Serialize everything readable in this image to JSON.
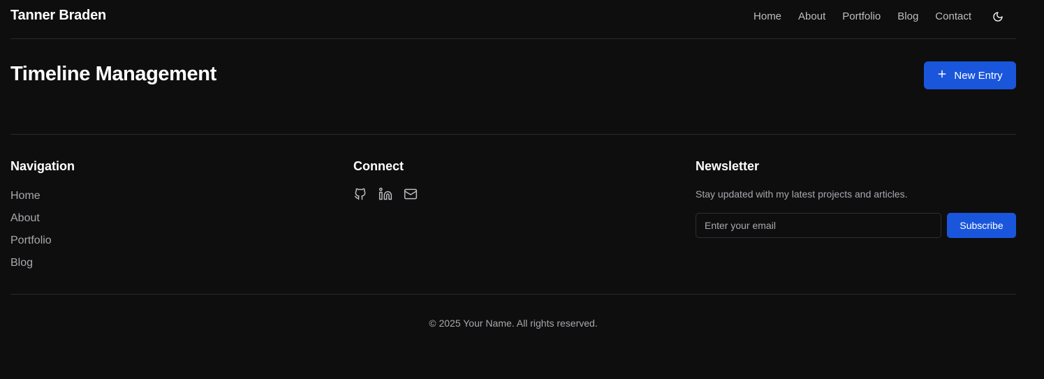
{
  "header": {
    "brand": "Tanner Braden",
    "nav": [
      "Home",
      "About",
      "Portfolio",
      "Blog",
      "Contact"
    ],
    "theme_icon": "moon-icon"
  },
  "main": {
    "title": "Timeline Management",
    "new_entry_label": "New Entry",
    "new_entry_icon": "plus-icon"
  },
  "footer": {
    "navigation": {
      "title": "Navigation",
      "items": [
        "Home",
        "About",
        "Portfolio",
        "Blog"
      ]
    },
    "connect": {
      "title": "Connect",
      "icons": [
        "github-icon",
        "linkedin-icon",
        "mail-icon"
      ]
    },
    "newsletter": {
      "title": "Newsletter",
      "description": "Stay updated with my latest projects and articles.",
      "email_placeholder": "Enter your email",
      "email_value": "",
      "subscribe_label": "Subscribe"
    },
    "copyright": "© 2025 Your Name. All rights reserved."
  },
  "colors": {
    "background": "#0e0e0f",
    "accent": "#1a56db",
    "muted_text": "#a9a9ae",
    "border": "#2a2a2c"
  }
}
